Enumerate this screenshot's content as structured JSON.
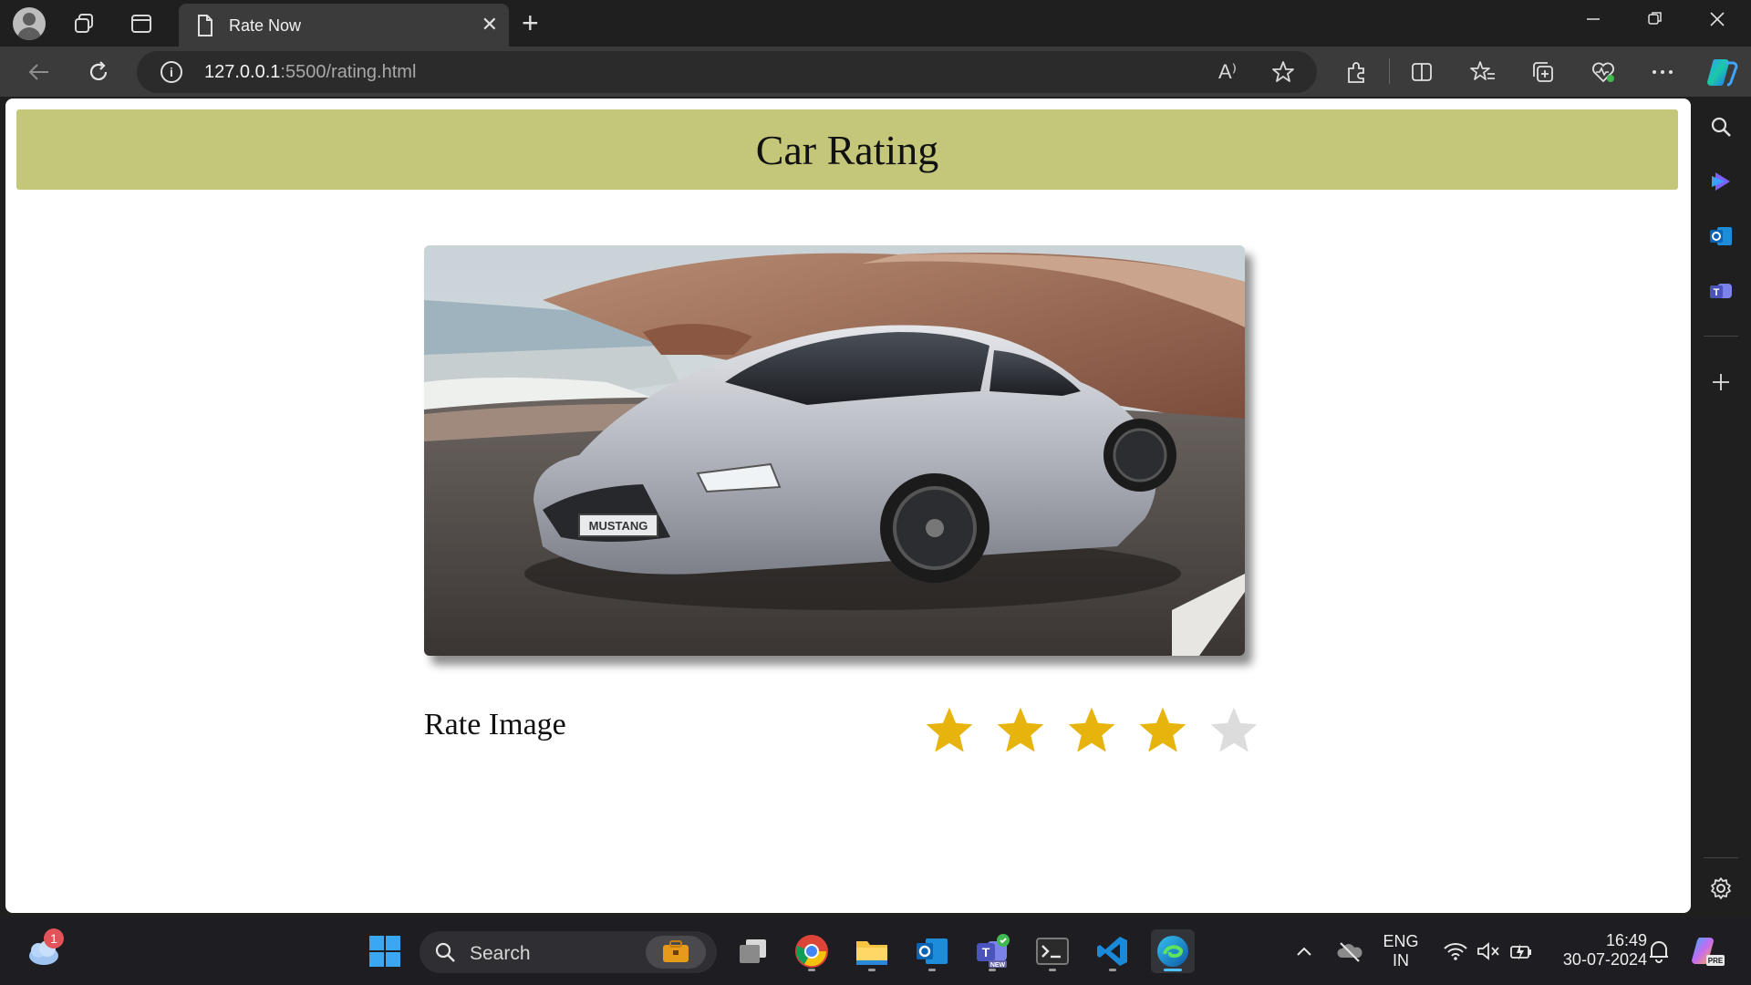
{
  "browser": {
    "tab_title": "Rate Now",
    "url_host": "127.0.0.1",
    "url_rest": ":5500/rating.html",
    "read_aloud_label": "A⁾"
  },
  "page": {
    "heading": "Car Rating",
    "rate_label": "Rate Image",
    "rating": {
      "value": 4,
      "max": 5,
      "filled_color": "#e7b40d",
      "empty_color": "#dcdcdc"
    },
    "header_color": "#c4c67a"
  },
  "taskbar": {
    "search_placeholder": "Search",
    "weather_badge": "1",
    "lang_top": "ENG",
    "lang_bottom": "IN",
    "time": "16:49",
    "date": "30-07-2024"
  }
}
